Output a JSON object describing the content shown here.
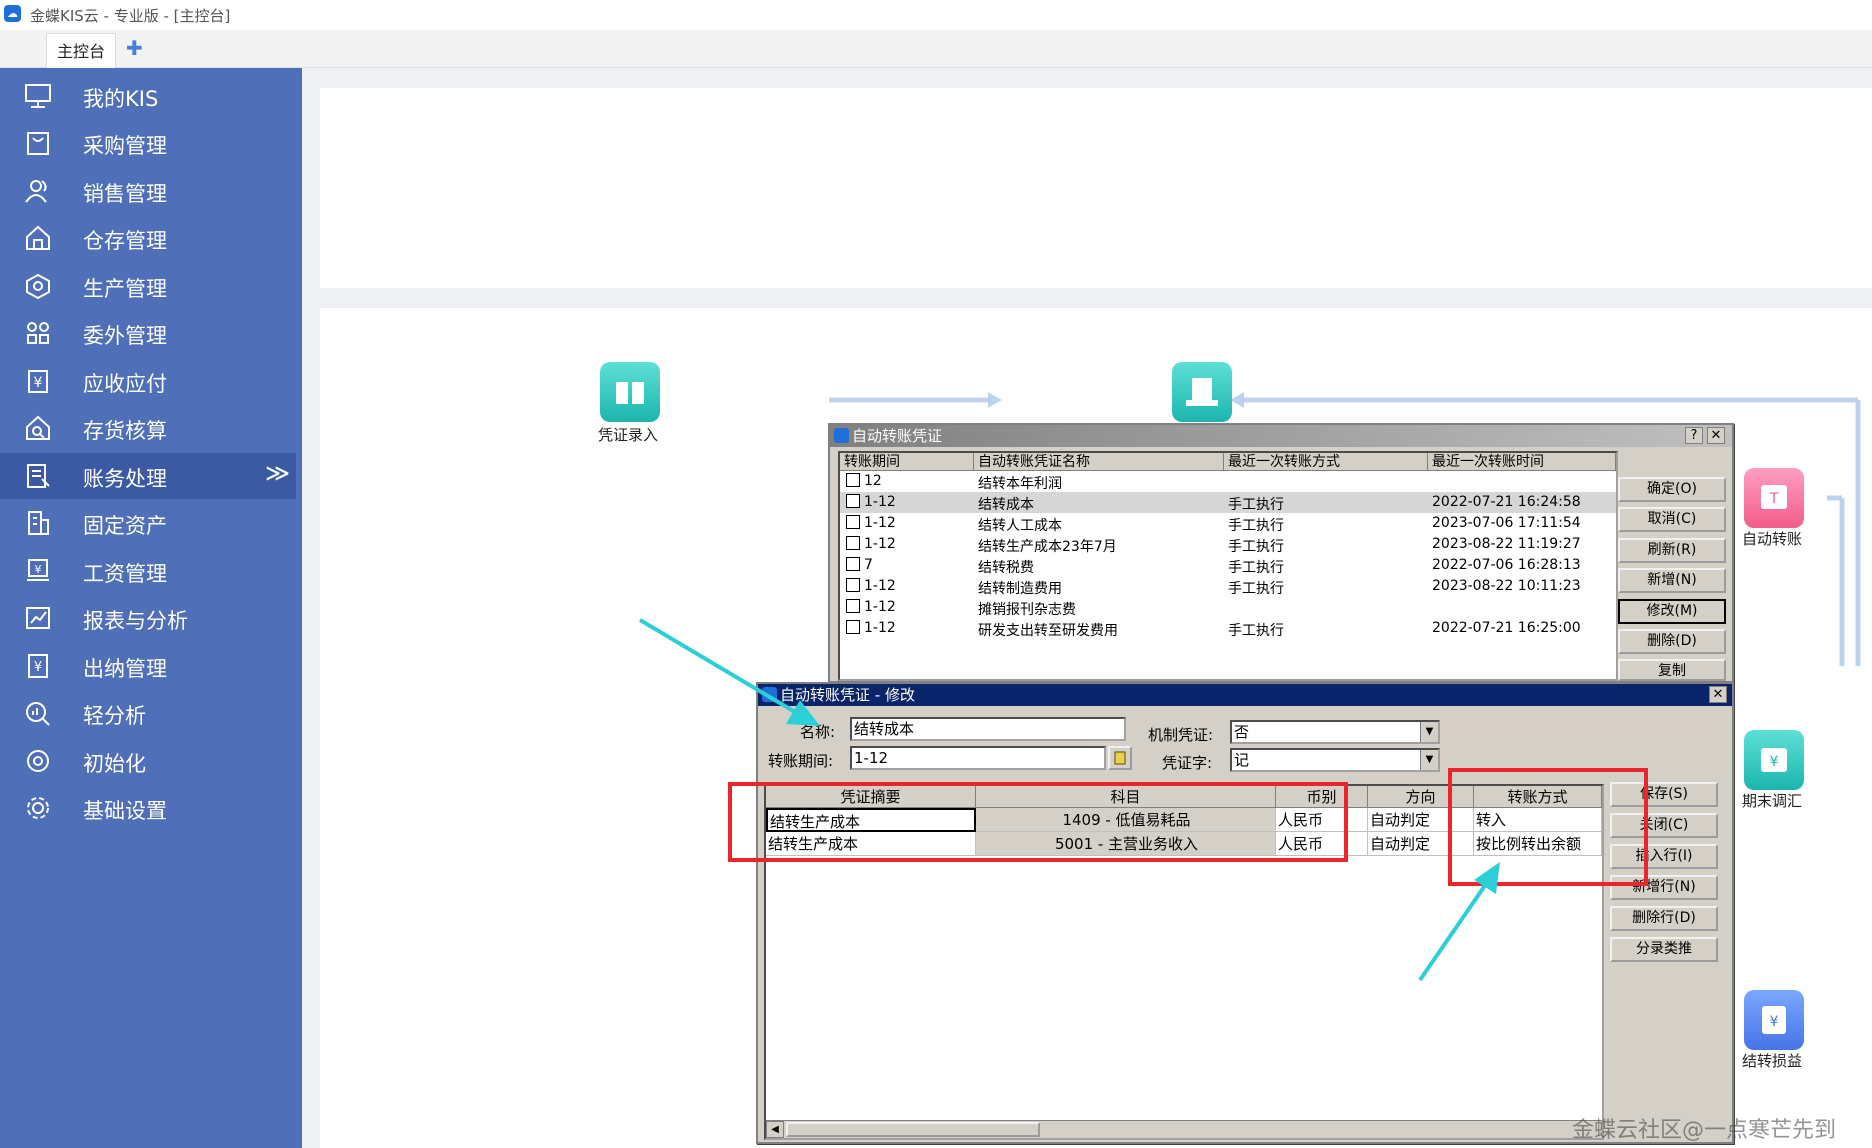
{
  "window": {
    "title": "金蝶KIS云 - 专业版 - [主控台]"
  },
  "tabs": {
    "main": "主控台",
    "add": "✚"
  },
  "sidebar": {
    "items": [
      {
        "label": "我的KIS",
        "icon": "monitor-icon"
      },
      {
        "label": "采购管理",
        "icon": "bag-icon"
      },
      {
        "label": "销售管理",
        "icon": "users-icon"
      },
      {
        "label": "仓存管理",
        "icon": "warehouse-icon"
      },
      {
        "label": "生产管理",
        "icon": "hexagon-icon"
      },
      {
        "label": "委外管理",
        "icon": "grid-icon"
      },
      {
        "label": "应收应付",
        "icon": "yen-box-icon"
      },
      {
        "label": "存货核算",
        "icon": "house-search-icon"
      },
      {
        "label": "账务处理",
        "icon": "ledger-icon"
      },
      {
        "label": "固定资产",
        "icon": "building-icon"
      },
      {
        "label": "工资管理",
        "icon": "salary-icon"
      },
      {
        "label": "报表与分析",
        "icon": "chart-icon"
      },
      {
        "label": "出纳管理",
        "icon": "cashier-icon"
      },
      {
        "label": "轻分析",
        "icon": "analysis-icon"
      },
      {
        "label": "初始化",
        "icon": "init-icon"
      },
      {
        "label": "基础设置",
        "icon": "settings-icon"
      }
    ],
    "active_chevron": "≫"
  },
  "flow": {
    "voucher_entry": "凭证录入",
    "auto_transfer": "自动转账",
    "period_adjust": "期末调汇",
    "carry_pl": "结转损益"
  },
  "dlg1": {
    "title": "自动转账凭证",
    "help": "?",
    "close": "✕",
    "headers": [
      "转账期间",
      "自动转账凭证名称",
      "最近一次转账方式",
      "最近一次转账时间"
    ],
    "rows": [
      {
        "period": "12",
        "name": "结转本年利润",
        "method": "",
        "time": ""
      },
      {
        "period": "1-12",
        "name": "结转成本",
        "method": "手工执行",
        "time": "2022-07-21 16:24:58"
      },
      {
        "period": "1-12",
        "name": "结转人工成本",
        "method": "手工执行",
        "time": "2023-07-06 17:11:54"
      },
      {
        "period": "1-12",
        "name": "结转生产成本23年7月",
        "method": "手工执行",
        "time": "2023-08-22 11:19:27"
      },
      {
        "period": "7",
        "name": "结转税费",
        "method": "手工执行",
        "time": "2022-07-06 16:28:13"
      },
      {
        "period": "1-12",
        "name": "结转制造费用",
        "method": "手工执行",
        "time": "2023-08-22 10:11:23"
      },
      {
        "period": "1-12",
        "name": "摊销报刊杂志费",
        "method": "",
        "time": ""
      },
      {
        "period": "1-12",
        "name": "研发支出转至研发费用",
        "method": "手工执行",
        "time": "2022-07-21 16:25:00"
      }
    ],
    "buttons": [
      "确定(O)",
      "取消(C)",
      "刷新(R)",
      "新增(N)",
      "修改(M)",
      "删除(D)",
      "复制"
    ]
  },
  "dlg2": {
    "title": "自动转账凭证 - 修改",
    "close": "✕",
    "name_label": "名称:",
    "name_value": "结转成本",
    "period_label": "转账期间:",
    "period_value": "1-12",
    "mech_label": "机制凭证:",
    "mech_value": "否",
    "word_label": "凭证字:",
    "word_value": "记",
    "headers": [
      "凭证摘要",
      "科目",
      "币别",
      "方向",
      "转账方式"
    ],
    "rows": [
      {
        "summary": "结转生产成本",
        "account": "1409 - 低值易耗品",
        "currency": "人民币",
        "direction": "自动判定",
        "mode": "转入"
      },
      {
        "summary": "结转生产成本",
        "account": "5001 - 主营业务收入",
        "currency": "人民币",
        "direction": "自动判定",
        "mode": "按比例转出余额"
      }
    ],
    "buttons": [
      "保存(S)",
      "关闭(C)",
      "插入行(I)",
      "新增行(N)",
      "删除行(D)",
      "分录类推"
    ]
  },
  "watermark": "金蝶云社区@一点寒芒先到",
  "colors": {
    "sidebar": "#4f6fb9",
    "sidebar_active": "#3c5aa3",
    "dialog_title": "#0a246a",
    "highlight": "#e8262b",
    "arrow": "#2ccfd6"
  }
}
